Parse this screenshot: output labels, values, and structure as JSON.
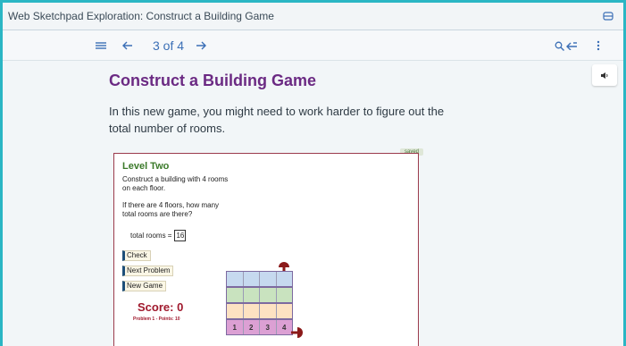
{
  "window": {
    "title": "Web Sketchpad Exploration: Construct a Building Game"
  },
  "nav": {
    "page_indicator": "3 of 4"
  },
  "page": {
    "heading": "Construct a Building Game",
    "intro": "In this new game, you might need to work harder to figure out the total number of rooms."
  },
  "sketch": {
    "saved_badge": "saved",
    "level": "Level Two",
    "prompt1": "Construct a building with 4 rooms on each floor.",
    "prompt2": "If there are 4 floors, how many total rooms are there?",
    "total_label": "total rooms =",
    "total_value": "16",
    "check": "Check",
    "next_problem": "Next Problem",
    "new_game": "New Game",
    "score": "Score: 0",
    "problem_points": "Problem 1 - Points: 10",
    "base_numbers": [
      "1",
      "2",
      "3",
      "4"
    ],
    "colors": {
      "floor_top": "#c6d9ef",
      "floor_2": "#c9e3bf",
      "floor_3": "#fde2c2",
      "base": "#dca0d4",
      "knob": "#8b1a1a"
    }
  }
}
